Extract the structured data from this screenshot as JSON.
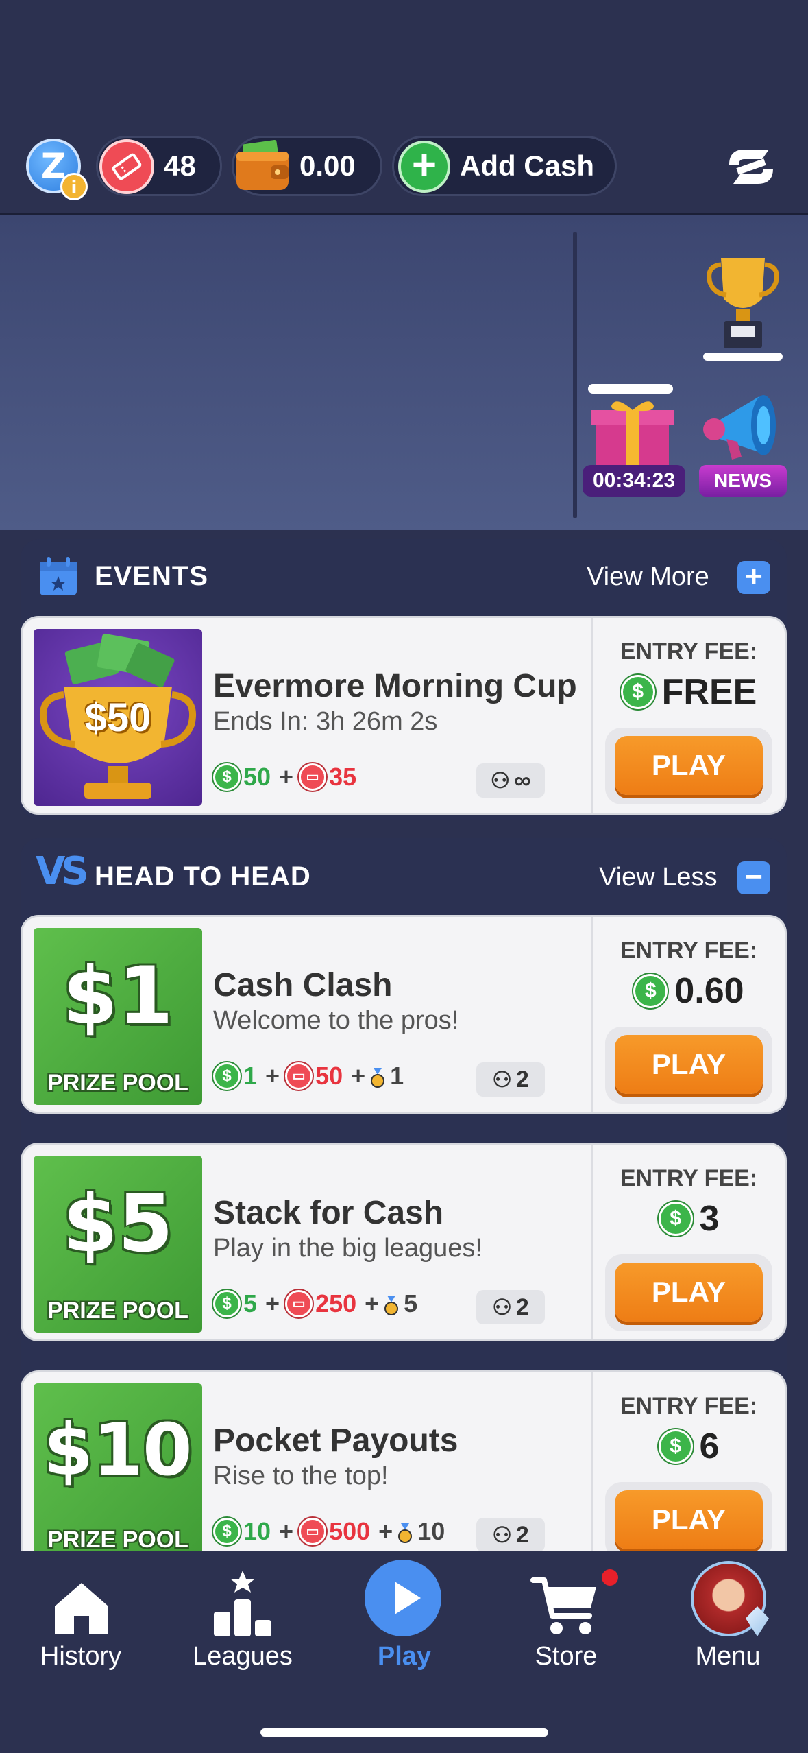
{
  "header": {
    "z_icon": "z-badge-icon",
    "tickets_count": "48",
    "wallet_balance": "0.00",
    "add_cash_label": "Add Cash",
    "sync_icon": "sync-logo-icon"
  },
  "hero": {
    "gift_timer": "00:34:23",
    "news_label": "NEWS"
  },
  "events": {
    "title": "EVENTS",
    "view_label": "View More",
    "cards": [
      {
        "name": "Evermore Morning Cup",
        "subtitle": "Ends In: 3h 26m 2s",
        "thumb_amount": "$50",
        "reward_cash": "50",
        "reward_tickets": "35",
        "players": "∞",
        "fee_label": "ENTRY FEE:",
        "fee_value": "FREE",
        "play_label": "PLAY"
      }
    ]
  },
  "h2h": {
    "vs_label": "VS",
    "title": "HEAD TO HEAD",
    "view_label": "View Less",
    "cards": [
      {
        "amount": "$1",
        "pool_label": "PRIZE POOL",
        "name": "Cash Clash",
        "subtitle": "Welcome to the pros!",
        "reward_cash": "1",
        "reward_tickets": "50",
        "reward_medals": "1",
        "players": "2",
        "fee_label": "ENTRY FEE:",
        "fee_value": "0.60",
        "play_label": "PLAY"
      },
      {
        "amount": "$5",
        "pool_label": "PRIZE POOL",
        "name": "Stack for Cash",
        "subtitle": "Play in the big leagues!",
        "reward_cash": "5",
        "reward_tickets": "250",
        "reward_medals": "5",
        "players": "2",
        "fee_label": "ENTRY FEE:",
        "fee_value": "3",
        "play_label": "PLAY"
      },
      {
        "amount": "$10",
        "pool_label": "PRIZE POOL",
        "name": "Pocket Payouts",
        "subtitle": "Rise to the top!",
        "reward_cash": "10",
        "reward_tickets": "500",
        "reward_medals": "10",
        "players": "2",
        "fee_label": "ENTRY FEE:",
        "fee_value": "6",
        "play_label": "PLAY"
      }
    ]
  },
  "nav": {
    "items": [
      {
        "label": "History",
        "icon": "home-icon"
      },
      {
        "label": "Leagues",
        "icon": "leagues-podium-icon"
      },
      {
        "label": "Play",
        "icon": "play-icon"
      },
      {
        "label": "Store",
        "icon": "cart-icon"
      },
      {
        "label": "Menu",
        "icon": "avatar"
      }
    ]
  },
  "colors": {
    "background": "#2c3150",
    "accent_blue": "#4a8ff0",
    "play_orange": "#f08418",
    "cash_green": "#2fa84a",
    "ticket_red": "#e8343f"
  }
}
